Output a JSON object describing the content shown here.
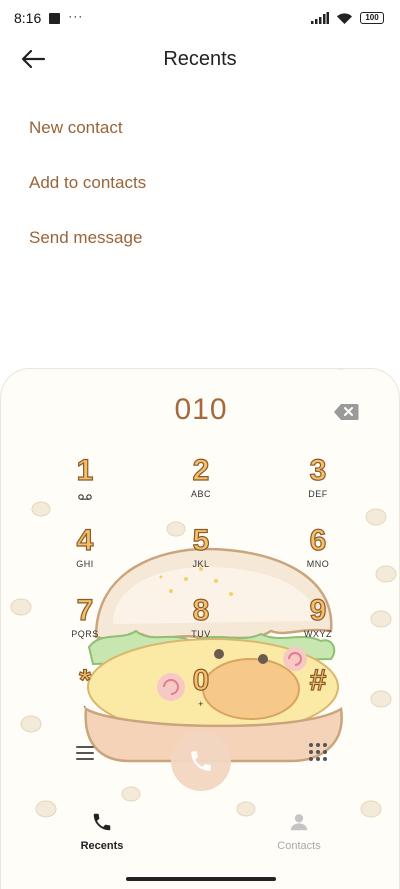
{
  "status_bar": {
    "time": "8:16",
    "dots": "···",
    "battery": "100"
  },
  "header": {
    "title": "Recents",
    "back_icon": "arrow-left-icon"
  },
  "menu": {
    "items": [
      {
        "label": "New contact"
      },
      {
        "label": "Add to contacts"
      },
      {
        "label": "Send message"
      }
    ]
  },
  "dialer": {
    "number": "010",
    "backspace_icon": "backspace-icon",
    "keys": [
      {
        "digit": "1",
        "letters": ""
      },
      {
        "digit": "2",
        "letters": "ABC"
      },
      {
        "digit": "3",
        "letters": "DEF"
      },
      {
        "digit": "4",
        "letters": "GHI"
      },
      {
        "digit": "5",
        "letters": "JKL"
      },
      {
        "digit": "6",
        "letters": "MNO"
      },
      {
        "digit": "7",
        "letters": "PQRS"
      },
      {
        "digit": "8",
        "letters": "TUV"
      },
      {
        "digit": "9",
        "letters": "WXYZ"
      },
      {
        "digit": "*",
        "letters": ","
      },
      {
        "digit": "0",
        "letters": "+"
      },
      {
        "digit": "#",
        "letters": ""
      }
    ],
    "accent_color": "#a46a3f"
  },
  "bottom_nav": {
    "tabs": [
      {
        "label": "Recents",
        "icon": "phone-icon",
        "active": true
      },
      {
        "label": "Contacts",
        "icon": "person-icon",
        "active": false
      }
    ]
  }
}
